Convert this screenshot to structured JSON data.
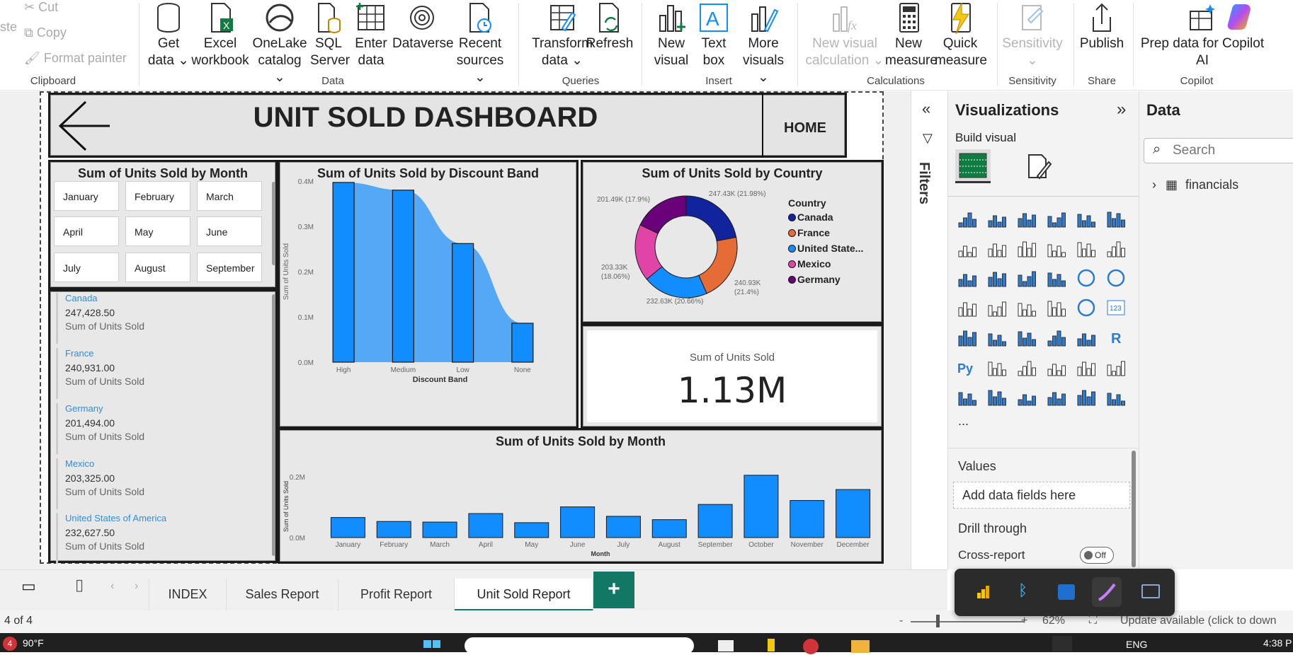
{
  "ribbon": {
    "clipboard": {
      "paste": "ste",
      "cut": "Cut",
      "copy": "Copy",
      "format_painter": "Format painter",
      "group": "Clipboard"
    },
    "data": {
      "get_data": [
        "Get",
        "data"
      ],
      "excel": [
        "Excel",
        "workbook"
      ],
      "onelake": [
        "OneLake",
        "catalog"
      ],
      "sql": [
        "SQL",
        "Server"
      ],
      "enter": [
        "Enter",
        "data"
      ],
      "dataverse": "Dataverse",
      "recent": [
        "Recent",
        "sources"
      ],
      "group": "Data"
    },
    "queries": {
      "transform": [
        "Transform",
        "data"
      ],
      "refresh": "Refresh",
      "group": "Queries"
    },
    "insert": {
      "new_visual": [
        "New",
        "visual"
      ],
      "text_box": [
        "Text",
        "box"
      ],
      "more_visuals": [
        "More",
        "visuals"
      ],
      "group": "Insert"
    },
    "calculations": {
      "new_visual_calc": [
        "New visual",
        "calculation"
      ],
      "new_measure": [
        "New",
        "measure"
      ],
      "quick_measure": [
        "Quick",
        "measure"
      ],
      "group": "Calculations"
    },
    "sensitivity": {
      "label": "Sensitivity",
      "group": "Sensitivity"
    },
    "share": {
      "publish": "Publish",
      "group": "Share"
    },
    "copilot": {
      "prep": [
        "Prep data for Copilot",
        "AI"
      ],
      "group": "Copilot"
    }
  },
  "dashboard": {
    "title": "UNIT SOLD DASHBOARD",
    "home": "HOME",
    "month_slicer": {
      "title": "Sum of Units Sold by Month",
      "months": [
        "January",
        "February",
        "March",
        "April",
        "May",
        "June",
        "July",
        "August",
        "September"
      ]
    },
    "country_cards": [
      {
        "name": "Canada",
        "value": "247,428.50",
        "label": "Sum of Units Sold"
      },
      {
        "name": "France",
        "value": "240,931.00",
        "label": "Sum of Units Sold"
      },
      {
        "name": "Germany",
        "value": "201,494.00",
        "label": "Sum of Units Sold"
      },
      {
        "name": "Mexico",
        "value": "203,325.00",
        "label": "Sum of Units Sold"
      },
      {
        "name": "United States of America",
        "value": "232,627.50",
        "label": "Sum of Units Sold"
      }
    ],
    "kpi": {
      "label": "Sum of Units Sold",
      "value": "1.13M"
    }
  },
  "chart_data": [
    {
      "type": "bar",
      "title": "Sum of Units Sold by Discount Band",
      "xlabel": "Discount Band",
      "ylabel": "Sum of Units Sold",
      "categories": [
        "High",
        "Medium",
        "Low",
        "None"
      ],
      "values": [
        0.397,
        0.38,
        0.262,
        0.086
      ],
      "ylim": [
        0,
        0.4
      ],
      "yticks": [
        "0.0M",
        "0.1M",
        "0.2M",
        "0.3M",
        "0.4M"
      ],
      "bar_color": "#118DFF",
      "area_color": "#55A8F5"
    },
    {
      "type": "pie",
      "title": "Sum of Units Sold by Country",
      "legend_title": "Country",
      "legend_position": "right",
      "labels": [
        "Canada",
        "France",
        "United State...",
        "Mexico",
        "Germany"
      ],
      "values": [
        247.43,
        240.93,
        232.63,
        203.33,
        201.49
      ],
      "data_labels": [
        "247.43K (21.98%)",
        "240.93K (21.4%)",
        "232.63K (20.66%)",
        "203.33K (18.06%)",
        "201.49K (17.9%)"
      ],
      "colors": [
        "#12239E",
        "#E66C37",
        "#118DFF",
        "#E044A7",
        "#6B007B"
      ]
    },
    {
      "type": "bar",
      "title": "Sum of Units Sold by Month",
      "xlabel": "Month",
      "ylabel": "Sum of Units Sold",
      "categories": [
        "January",
        "February",
        "March",
        "April",
        "May",
        "June",
        "July",
        "August",
        "September",
        "October",
        "November",
        "December"
      ],
      "values": [
        0.066,
        0.053,
        0.051,
        0.079,
        0.049,
        0.101,
        0.07,
        0.059,
        0.109,
        0.205,
        0.122,
        0.158
      ],
      "ylim": [
        0,
        0.2
      ],
      "yticks": [
        "0.0M",
        "0.2M"
      ],
      "bar_color": "#118DFF"
    }
  ],
  "filters": {
    "label": "Filters"
  },
  "visualizations": {
    "title": "Visualizations",
    "build_visual": "Build visual",
    "more": "...",
    "values_label": "Values",
    "add_fields": "Add data fields here",
    "drill_through": "Drill through",
    "cross_report": "Cross-report",
    "toggle": "Off"
  },
  "data_pane": {
    "title": "Data",
    "search_placeholder": "Search",
    "tables": [
      "financials"
    ]
  },
  "page_tabs": {
    "tabs": [
      "INDEX",
      "Sales Report",
      "Profit Report",
      "Unit Sold Report"
    ],
    "active": "Unit Sold Report",
    "add": "+"
  },
  "status_bar": {
    "page": "4 of 4",
    "zoom": "62%",
    "update": "Update available (click to down"
  },
  "taskbar": {
    "weather": "90°F",
    "badge": "4",
    "lang": "ENG",
    "time": "4:38 P"
  }
}
